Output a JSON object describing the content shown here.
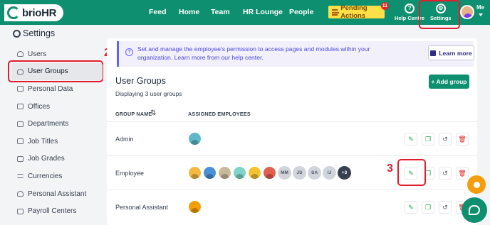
{
  "brand": {
    "logo_text": "brioHR"
  },
  "nav": {
    "links": [
      "Feed",
      "Home",
      "Team",
      "HR Lounge",
      "People"
    ],
    "pending_label": "Pending Actions",
    "pending_count": "11",
    "help_label": "Help Centre",
    "settings_label": "Settings",
    "me_label": "Me"
  },
  "page": {
    "title": "Settings"
  },
  "sidebar": {
    "items": [
      {
        "label": "Users",
        "icon": "users-icon"
      },
      {
        "label": "User Groups",
        "icon": "user-groups-icon",
        "active": true
      },
      {
        "label": "Personal Data",
        "icon": "personal-data-icon"
      },
      {
        "label": "Offices",
        "icon": "office-icon"
      },
      {
        "label": "Departments",
        "icon": "department-icon"
      },
      {
        "label": "Job Titles",
        "icon": "job-title-icon"
      },
      {
        "label": "Job Grades",
        "icon": "job-grade-icon"
      },
      {
        "label": "Currencies",
        "icon": "currency-icon"
      },
      {
        "label": "Personal Assistant",
        "icon": "assistant-icon"
      },
      {
        "label": "Payroll Centers",
        "icon": "payroll-icon"
      }
    ]
  },
  "info": {
    "text": "Set and manage the employee's permission to access pages and modules within your organization. Learn more from our help center.",
    "learn_more_label": "Learn more"
  },
  "groups": {
    "title": "User Groups",
    "subtitle": "Displaying 3 user groups",
    "add_label": "+ Add group",
    "col_name": "GROUP NAME",
    "col_employees": "ASSIGNED EMPLOYEES",
    "rows": [
      {
        "name": "Admin"
      },
      {
        "name": "Employee",
        "initials": [
          "MM",
          "JS",
          "SA",
          "IJ"
        ],
        "more": "+3"
      },
      {
        "name": "Personal Assistant"
      }
    ]
  },
  "annotations": {
    "step2": "2",
    "step3": "3"
  },
  "colors": {
    "brand": "#0e8f6f",
    "annotation": "#e11d2e",
    "pending": "#fde047"
  }
}
